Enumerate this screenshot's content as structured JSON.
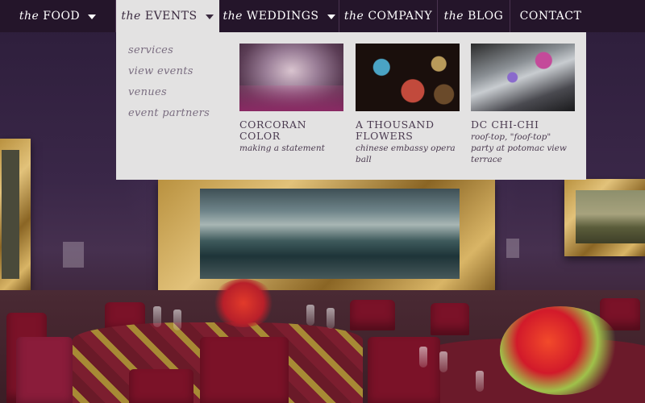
{
  "nav": {
    "items": [
      {
        "prefix": "the",
        "label": "FOOD",
        "has_caret": true
      },
      {
        "prefix": "the",
        "label": "EVENTS",
        "has_caret": true,
        "active": true
      },
      {
        "prefix": "the",
        "label": "WEDDINGS",
        "has_caret": true
      },
      {
        "prefix": "the",
        "label": "COMPANY",
        "has_caret": false
      },
      {
        "prefix": "the",
        "label": "BLOG",
        "has_caret": false
      },
      {
        "prefix": "",
        "label": "CONTACT",
        "has_caret": false
      }
    ]
  },
  "dropdown": {
    "submenu": [
      "services",
      "view events",
      "venues",
      "event partners"
    ],
    "features": [
      {
        "title": "CORCORAN COLOR",
        "subtitle": "making a statement"
      },
      {
        "title": "A THOUSAND FLOWERS",
        "subtitle": "chinese embassy opera ball"
      },
      {
        "title": "DC CHI-CHI",
        "subtitle": "roof-top, \"foof-top\" party at potomac view terrace"
      }
    ]
  },
  "colors": {
    "nav_bg": "#24152a",
    "dropdown_bg": "#e3e2e2",
    "submenu_text": "#7a6d80",
    "feature_text": "#4a3a4f"
  },
  "icons": {
    "caret": "caret-down-icon"
  }
}
